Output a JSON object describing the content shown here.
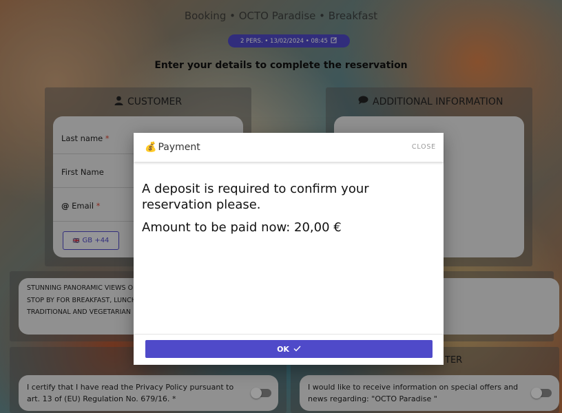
{
  "header": {
    "title": "Booking • OCTO Paradise • Breakfast",
    "summary": "2 PERS. • 13/02/2024 • 08:45",
    "intro": "Enter your details to complete the reservation"
  },
  "customer": {
    "title": "CUSTOMER",
    "last_name_label": "Last name",
    "first_name_label": "First Name",
    "email_label": "Email",
    "required_mark": "*",
    "phone_country": "GB +44",
    "flag": "🇬🇧"
  },
  "additional": {
    "title": "ADDITIONAL INFORMATION"
  },
  "description": {
    "lines": [
      "STUNNING PANORAMIC VIEWS O",
      "STOP BY FOR BREAKFAST, LUNCH",
      "TRADITIONAL AND VEGETARIAN"
    ]
  },
  "consents": {
    "privacy": "I certify that I have read the Privacy Policy pursuant to art. 13 of (EU) Regulation No. 679/16.",
    "privacy_required": "*",
    "marketing": "I would like to receive information on special offers and news regarding: \"OCTO Paradise \"",
    "hidden_section_tail": "TER"
  },
  "modal": {
    "icon": "💰",
    "title": "Payment",
    "close_label": "CLOSE",
    "message": "A deposit is required to confirm your reservation please.",
    "amount_text": "Amount to be paid now: 20,00 €",
    "ok_label": "OK"
  },
  "colors": {
    "accent": "#4f4ac9",
    "required": "#dd4433"
  }
}
